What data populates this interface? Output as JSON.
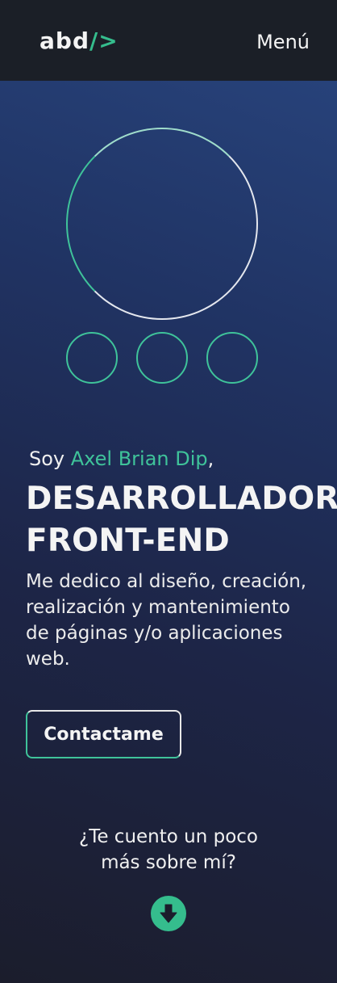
{
  "header": {
    "logo_text": "abd",
    "logo_accent": "/>",
    "menu_label": "Menú"
  },
  "hero": {
    "intro_prefix": "Soy ",
    "name": "Axel Brian Dip",
    "intro_suffix": ",",
    "role_line1": "DESARROLLADOR",
    "role_line2": "FRONT-END",
    "description": "Me dedico al diseño, creación, realización y mantenimiento de páginas y/o aplicaciones web.",
    "contact_label": "Contactame",
    "more_line1": "¿Te cuento un poco",
    "more_line2": "más sobre mí?"
  },
  "icons": {
    "scroll_down": "arrow-down-circle-icon"
  },
  "colors": {
    "accent": "#35bd8d",
    "header_bg": "#1b1f27",
    "hero_bg_top": "#27427a",
    "hero_bg_bottom": "#1b1d2c",
    "text": "#f4f4f4"
  }
}
